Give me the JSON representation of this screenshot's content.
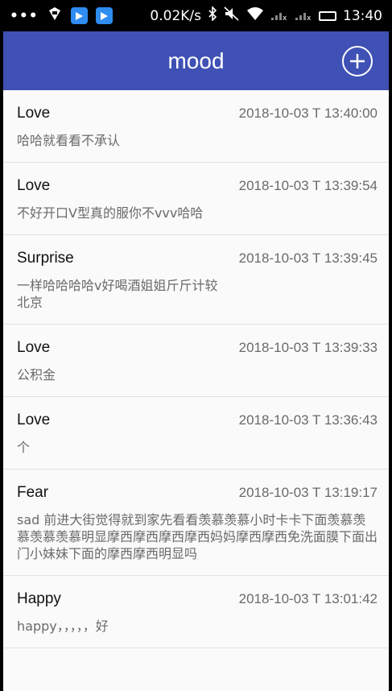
{
  "status_bar": {
    "dots": "•••",
    "speed": "0.02K/s",
    "time": "13:40"
  },
  "appbar": {
    "title": "mood",
    "add_icon": "plus-circle-icon"
  },
  "entries": [
    {
      "mood": "Love",
      "time": "2018-10-03 T 13:40:00",
      "text": "哈哈就看看不承认"
    },
    {
      "mood": "Love",
      "time": "2018-10-03 T 13:39:54",
      "text": "不好开口V型真的服你不vvv哈哈"
    },
    {
      "mood": "Surprise",
      "time": "2018-10-03 T 13:39:45",
      "text": "一样哈哈哈哈v好喝酒姐姐斤斤计较\n北京"
    },
    {
      "mood": "Love",
      "time": "2018-10-03 T 13:39:33",
      "text": "公积金"
    },
    {
      "mood": "Love",
      "time": "2018-10-03 T 13:36:43",
      "text": "个"
    },
    {
      "mood": "Fear",
      "time": "2018-10-03 T 13:19:17",
      "text": "sad 前进大街觉得就到家先看看羡慕羡慕小时卡卡下面羡慕羡慕羡慕羡慕明显摩西摩西摩西摩西妈妈摩西摩西免洗面膜下面出门小妹妹下面的摩西摩西明显吗"
    },
    {
      "mood": "Happy",
      "time": "2018-10-03 T 13:01:42",
      "text": "happy，，，，，好"
    }
  ]
}
